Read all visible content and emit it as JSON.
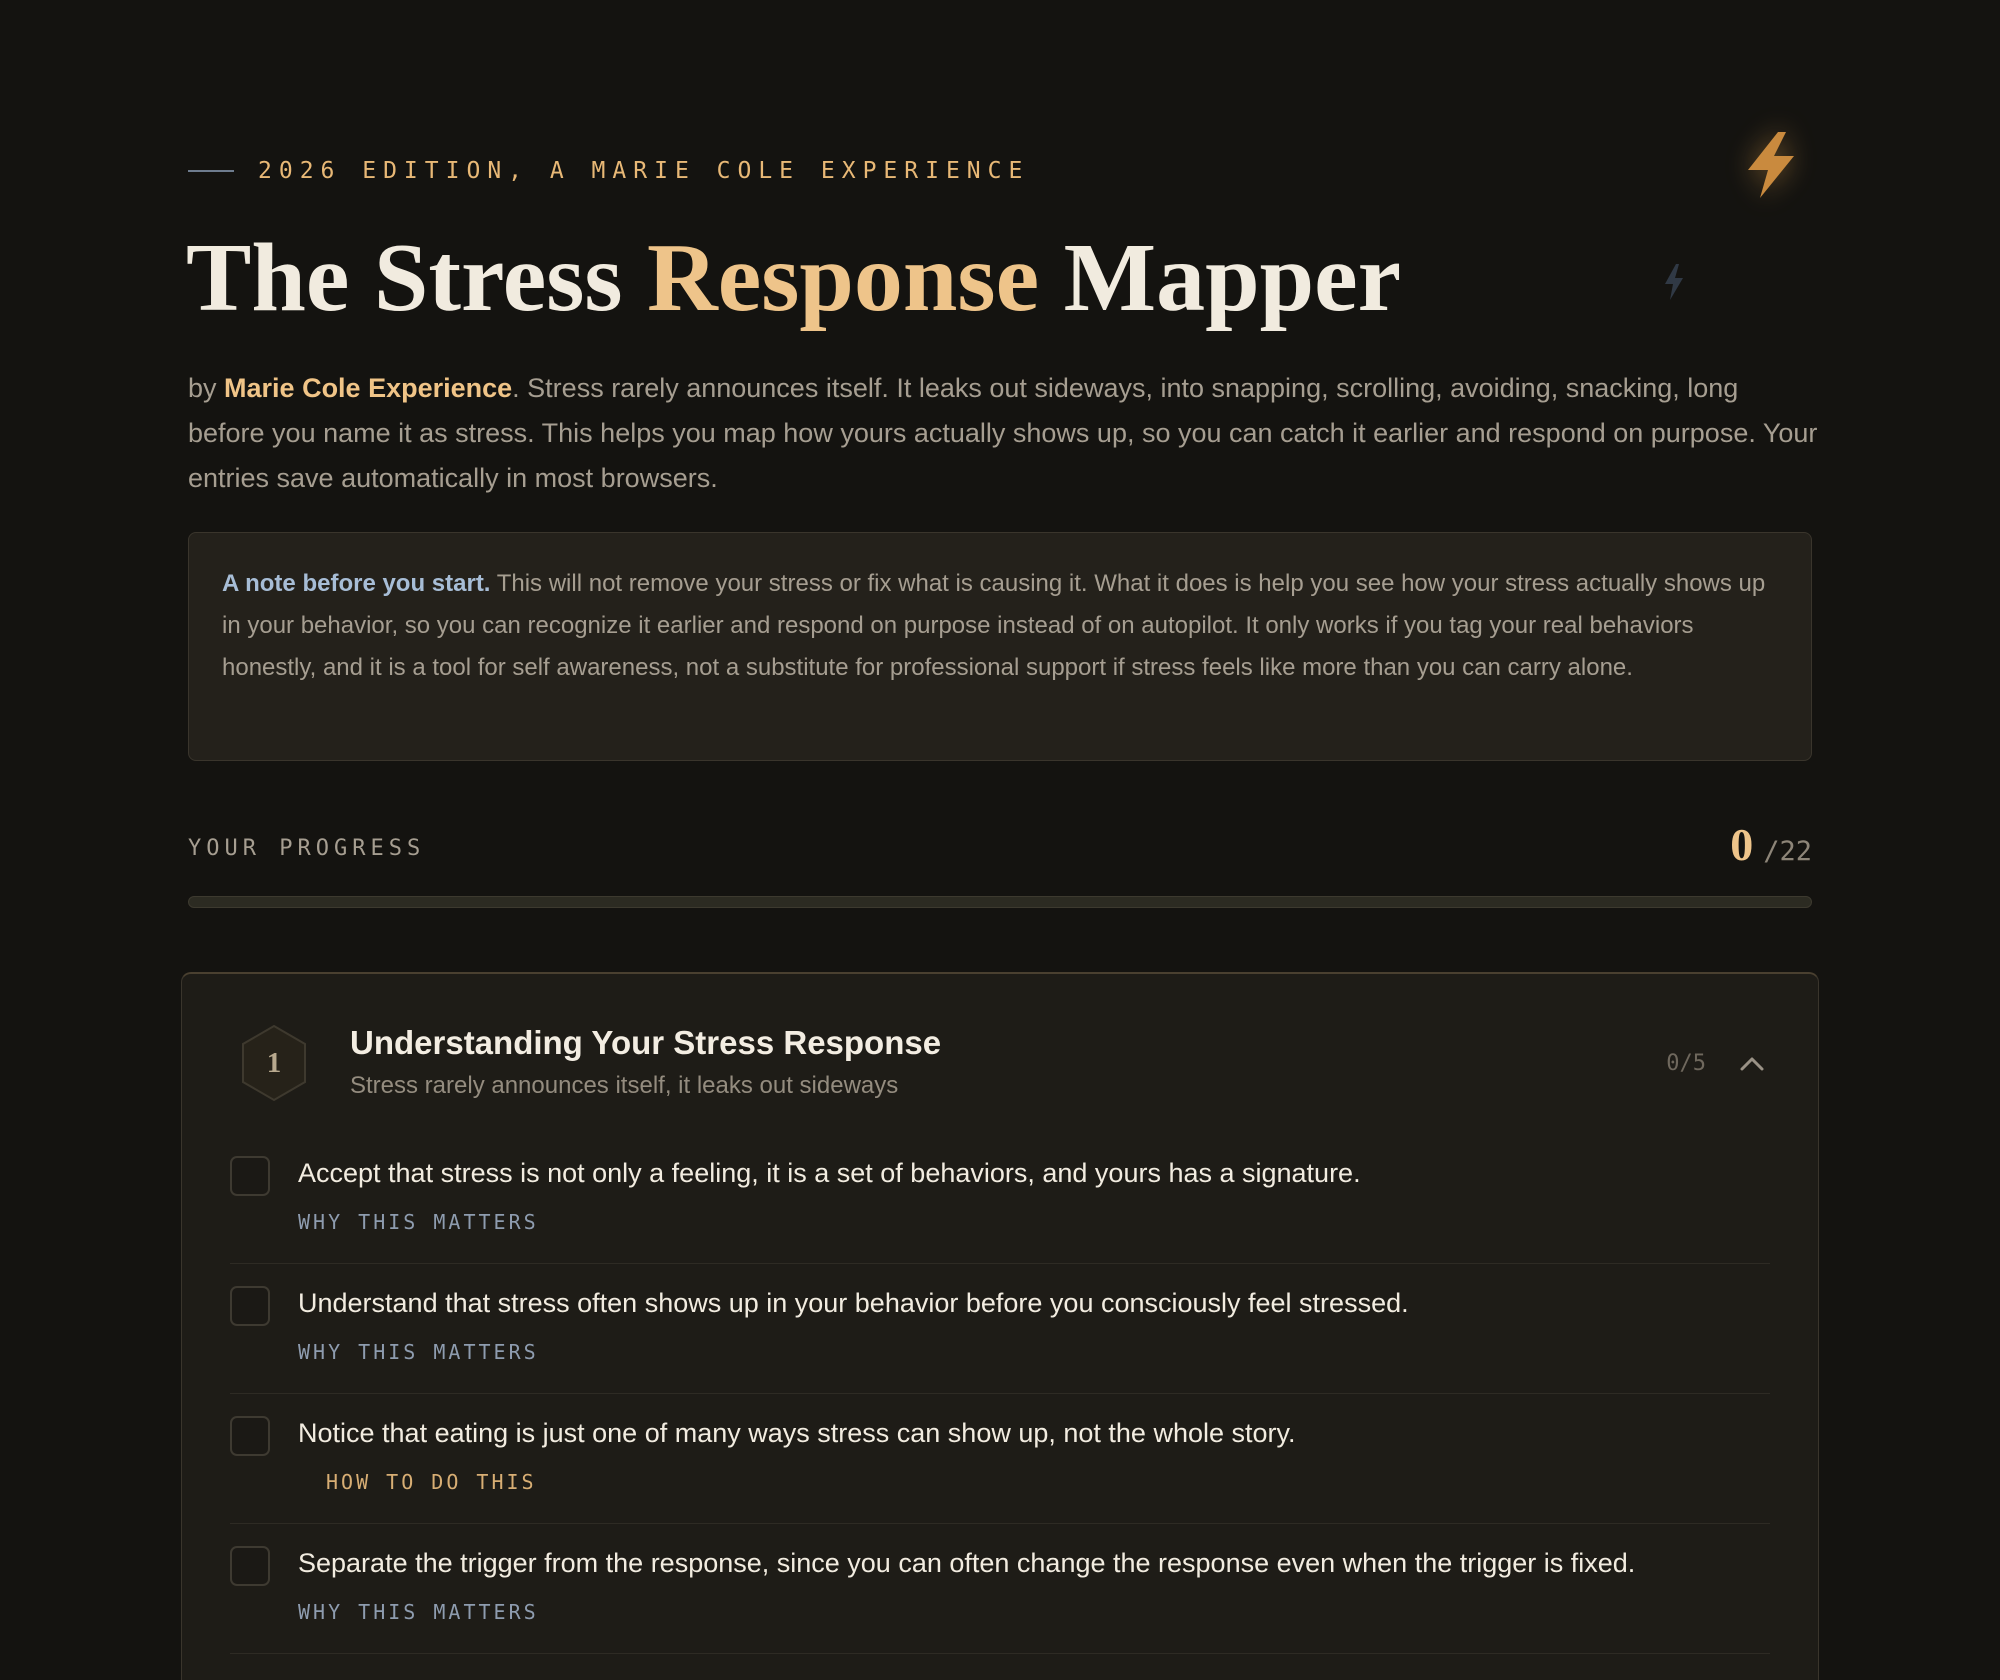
{
  "header": {
    "eyebrow": "2026 EDITION, A MARIE COLE EXPERIENCE",
    "title_part1": "The Stress ",
    "title_accent": "Response",
    "title_part2": " Mapper",
    "intro_prefix": "by ",
    "intro_author": "Marie Cole Experience",
    "intro_body": ". Stress rarely announces itself. It leaks out sideways, into snapping, scrolling, avoiding, snacking, long before you name it as stress. This helps you map how yours actually shows up, so you can catch it earlier and respond on purpose. Your entries save automatically in most browsers."
  },
  "icons": {
    "decor_large": "lightning-bolt-icon",
    "decor_small": "lightning-bolt-icon",
    "collapse": "chevron-up-icon"
  },
  "note": {
    "lead": "A note before you start.",
    "body": " This will not remove your stress or fix what is causing it. What it does is help you see how your stress actually shows up in your behavior, so you can recognize it earlier and respond on purpose instead of on autopilot. It only works if you tag your real behaviors honestly, and it is a tool for self awareness, not a substitute for professional support if stress feels like more than you can carry alone."
  },
  "progress": {
    "label": "YOUR PROGRESS",
    "done": "0",
    "total": "/22",
    "fraction": 0
  },
  "section": {
    "number": "1",
    "title": "Understanding Your Stress Response",
    "subtitle": "Stress rarely announces itself, it leaks out sideways",
    "count": "0/5",
    "items": [
      {
        "text": "Accept that stress is not only a feeling, it is a set of behaviors, and yours has a signature.",
        "link": "WHY THIS MATTERS",
        "checked": false
      },
      {
        "text": "Understand that stress often shows up in your behavior before you consciously feel stressed.",
        "link": "WHY THIS MATTERS",
        "checked": false
      },
      {
        "text": "Notice that eating is just one of many ways stress can show up, not the whole story.",
        "link": "HOW TO DO THIS",
        "checked": false
      },
      {
        "text": "Separate the trigger from the response, since you can often change the response even when the trigger is fixed.",
        "link": "WHY THIS MATTERS",
        "checked": false
      }
    ]
  },
  "colors": {
    "background": "#141310",
    "accent": "#eec48a",
    "card": "#24211b",
    "note_lead": "#a7bdd6"
  }
}
